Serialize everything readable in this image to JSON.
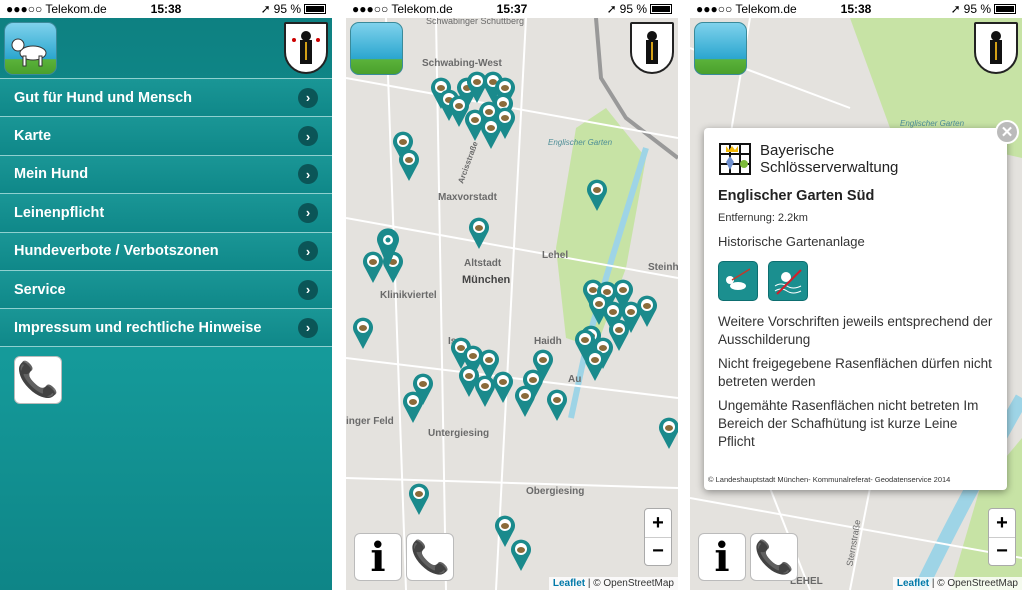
{
  "colors": {
    "teal": "#128f90",
    "pin": "#1a8a8c",
    "leaflet": "#0078a8"
  },
  "screens": [
    {
      "status": {
        "carrier": "●●●○○ Telekom.de",
        "time": "15:38",
        "battery": "95 %"
      },
      "menu": [
        {
          "label": "Gut für Hund und Mensch"
        },
        {
          "label": "Karte"
        },
        {
          "label": "Mein Hund"
        },
        {
          "label": "Leinenpflicht"
        },
        {
          "label": "Hundeverbote / Verbotszonen"
        },
        {
          "label": "Service"
        },
        {
          "label": "Impressum und rechtliche Hinweise"
        }
      ],
      "icons": {
        "app": "dog-icon",
        "crest": "munich-crest-icon",
        "call": "phone-icon",
        "chevron": "chevron-right-icon"
      }
    },
    {
      "status": {
        "carrier": "●●●○○ Telekom.de",
        "time": "15:37",
        "battery": "95 %"
      },
      "map_labels": [
        "Schwabinger Schuttberg",
        "Schwabing-West",
        "Arcisstraße",
        "Englischer Garten",
        "Maxvorstadt",
        "Altstadt",
        "München",
        "Lehel",
        "Steinh",
        "Klinikviertel",
        "Isar",
        "Haidh",
        "Au",
        "inger Feld",
        "Untergiesing",
        "Obergiesing"
      ],
      "info_label": "i",
      "zoom": {
        "in": "+",
        "out": "−"
      },
      "attribution": {
        "leaflet": "Leaflet",
        "osm": "| © OpenStreetMap"
      }
    },
    {
      "status": {
        "carrier": "●●●○○ Telekom.de",
        "time": "15:38",
        "battery": "95 %"
      },
      "map_labels": [
        "Englischer Garten",
        "Sternstraße",
        "LEHEL"
      ],
      "popup": {
        "org": "Bayerische Schlösserverwaltung",
        "org_line1": "Bayerische",
        "org_line2": "Schlösserverwaltung",
        "title": "Englischer Garten Süd",
        "distance": "Entfernung: 2.2km",
        "category": "Historische Gartenanlage",
        "pictograms": [
          "dog-on-leash-icon",
          "no-swimming-dog-icon"
        ],
        "rules": [
          "Weitere Vorschriften jeweils entsprechend der Ausschilderung",
          "Nicht freigegebene Rasenflächen dürfen nicht betreten werden",
          "Ungemähte Rasenflächen nicht betreten Im Bereich der Schafhütung ist kurze Leine Pflicht"
        ],
        "copyright": "© Landeshauptstadt München- Kommunalreferat- Geodatenservice 2014",
        "close": "✕"
      },
      "info_label": "i",
      "zoom": {
        "in": "+",
        "out": "−"
      },
      "attribution": {
        "leaflet": "Leaflet",
        "osm": "| © OpenStreetMap"
      }
    }
  ]
}
